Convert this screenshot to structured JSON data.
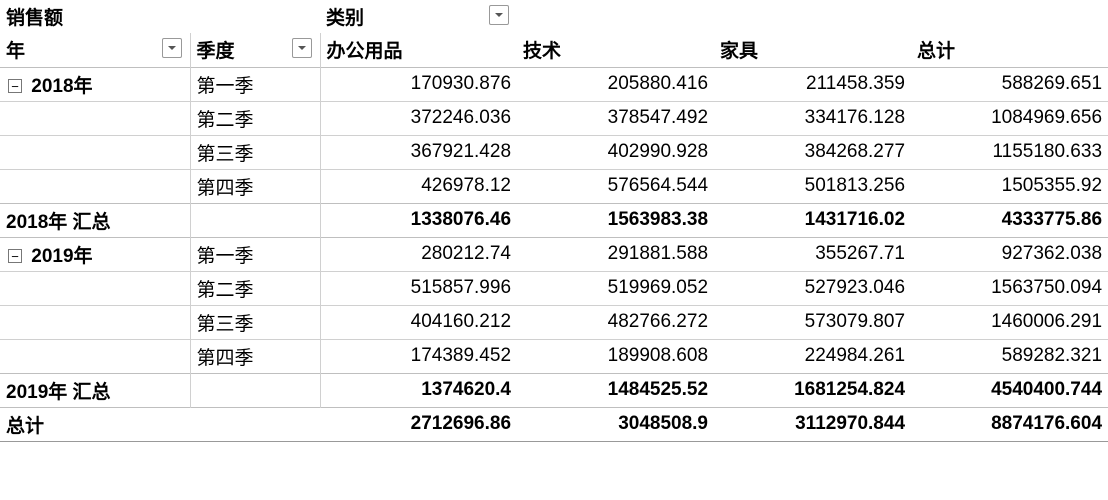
{
  "header": {
    "measure": "销售额",
    "col_dim": "类别",
    "row_year": "年",
    "row_quarter": "季度",
    "categories": [
      "办公用品",
      "技术",
      "家具"
    ],
    "total_label": "总计"
  },
  "groups": [
    {
      "year_label": "2018年",
      "rows": [
        {
          "quarter": "第一季",
          "v": [
            "170930.876",
            "205880.416",
            "211458.359",
            "588269.651"
          ]
        },
        {
          "quarter": "第二季",
          "v": [
            "372246.036",
            "378547.492",
            "334176.128",
            "1084969.656"
          ]
        },
        {
          "quarter": "第三季",
          "v": [
            "367921.428",
            "402990.928",
            "384268.277",
            "1155180.633"
          ]
        },
        {
          "quarter": "第四季",
          "v": [
            "426978.12",
            "576564.544",
            "501813.256",
            "1505355.92"
          ]
        }
      ],
      "subtotal": {
        "label": "2018年 汇总",
        "v": [
          "1338076.46",
          "1563983.38",
          "1431716.02",
          "4333775.86"
        ]
      }
    },
    {
      "year_label": "2019年",
      "rows": [
        {
          "quarter": "第一季",
          "v": [
            "280212.74",
            "291881.588",
            "355267.71",
            "927362.038"
          ]
        },
        {
          "quarter": "第二季",
          "v": [
            "515857.996",
            "519969.052",
            "527923.046",
            "1563750.094"
          ]
        },
        {
          "quarter": "第三季",
          "v": [
            "404160.212",
            "482766.272",
            "573079.807",
            "1460006.291"
          ]
        },
        {
          "quarter": "第四季",
          "v": [
            "174389.452",
            "189908.608",
            "224984.261",
            "589282.321"
          ]
        }
      ],
      "subtotal": {
        "label": "2019年 汇总",
        "v": [
          "1374620.4",
          "1484525.52",
          "1681254.824",
          "4540400.744"
        ]
      }
    }
  ],
  "grand_total": {
    "label": "总计",
    "v": [
      "2712696.86",
      "3048508.9",
      "3112970.844",
      "8874176.604"
    ]
  },
  "chart_data": {
    "type": "table",
    "title": "销售额 by 年/季度 × 类别",
    "row_fields": [
      "年",
      "季度"
    ],
    "col_field": "类别",
    "categories": [
      "办公用品",
      "技术",
      "家具",
      "总计"
    ],
    "rows": [
      {
        "year": "2018年",
        "quarter": "第一季",
        "values": [
          170930.876,
          205880.416,
          211458.359,
          588269.651
        ]
      },
      {
        "year": "2018年",
        "quarter": "第二季",
        "values": [
          372246.036,
          378547.492,
          334176.128,
          1084969.656
        ]
      },
      {
        "year": "2018年",
        "quarter": "第三季",
        "values": [
          367921.428,
          402990.928,
          384268.277,
          1155180.633
        ]
      },
      {
        "year": "2018年",
        "quarter": "第四季",
        "values": [
          426978.12,
          576564.544,
          501813.256,
          1505355.92
        ]
      },
      {
        "year": "2018年 汇总",
        "quarter": "",
        "values": [
          1338076.46,
          1563983.38,
          1431716.02,
          4333775.86
        ]
      },
      {
        "year": "2019年",
        "quarter": "第一季",
        "values": [
          280212.74,
          291881.588,
          355267.71,
          927362.038
        ]
      },
      {
        "year": "2019年",
        "quarter": "第二季",
        "values": [
          515857.996,
          519969.052,
          527923.046,
          1563750.094
        ]
      },
      {
        "year": "2019年",
        "quarter": "第三季",
        "values": [
          404160.212,
          482766.272,
          573079.807,
          1460006.291
        ]
      },
      {
        "year": "2019年",
        "quarter": "第四季",
        "values": [
          174389.452,
          189908.608,
          224984.261,
          589282.321
        ]
      },
      {
        "year": "2019年 汇总",
        "quarter": "",
        "values": [
          1374620.4,
          1484525.52,
          1681254.824,
          4540400.744
        ]
      },
      {
        "year": "总计",
        "quarter": "",
        "values": [
          2712696.86,
          3048508.9,
          3112970.844,
          8874176.604
        ]
      }
    ]
  }
}
